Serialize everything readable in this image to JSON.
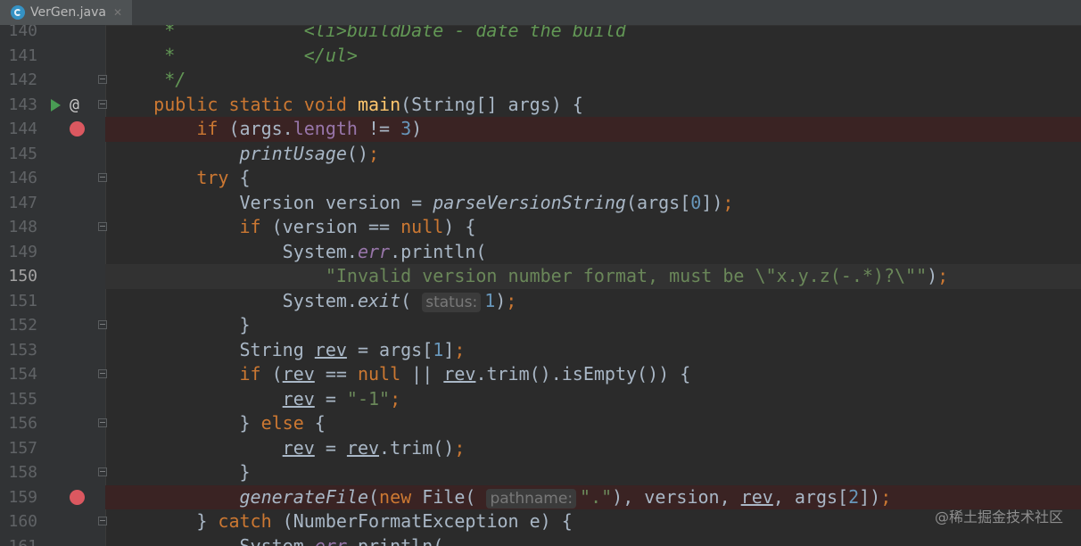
{
  "tab": {
    "label": "VerGen.java",
    "icon": "java-class-icon",
    "close": "✕"
  },
  "watermark": "@稀土掘金技术社区",
  "lines": [
    {
      "n": "140",
      "segs": [
        [
          "cmt",
          "     *            <li>buildDate - date the build"
        ]
      ]
    },
    {
      "n": "141",
      "segs": [
        [
          "cmt",
          "     *            </ul>"
        ]
      ]
    },
    {
      "n": "142",
      "fold": true,
      "segs": [
        [
          "cmt",
          "     */"
        ]
      ]
    },
    {
      "n": "143",
      "run": true,
      "at": "@",
      "fold": true,
      "segs": [
        [
          "kw",
          "    public static void "
        ],
        [
          "fn",
          "main"
        ],
        [
          "",
          "(String[] args) {"
        ]
      ]
    },
    {
      "n": "144",
      "bp": true,
      "segs": [
        [
          "kw",
          "        if "
        ],
        [
          "",
          "(args."
        ],
        [
          "fld",
          "length"
        ],
        [
          "",
          " != "
        ],
        [
          "num",
          "3"
        ],
        [
          "",
          ")"
        ]
      ]
    },
    {
      "n": "145",
      "segs": [
        [
          "ital",
          "            printUsage"
        ],
        [
          "",
          "()"
        ],
        [
          "kw",
          ";"
        ]
      ]
    },
    {
      "n": "146",
      "fold": true,
      "segs": [
        [
          "kw",
          "        try "
        ],
        [
          "",
          "{"
        ]
      ]
    },
    {
      "n": "147",
      "segs": [
        [
          "",
          "            Version version = "
        ],
        [
          "ital",
          "parseVersionString"
        ],
        [
          "",
          "(args["
        ],
        [
          "num",
          "0"
        ],
        [
          "",
          "])"
        ],
        [
          "kw",
          ";"
        ]
      ]
    },
    {
      "n": "148",
      "fold": true,
      "segs": [
        [
          "kw",
          "            if "
        ],
        [
          "",
          "(version == "
        ],
        [
          "kw",
          "null"
        ],
        [
          "",
          ") {"
        ]
      ]
    },
    {
      "n": "149",
      "segs": [
        [
          "",
          "                System."
        ],
        [
          "st",
          "err"
        ],
        [
          "",
          ".println("
        ]
      ]
    },
    {
      "n": "150",
      "caret": true,
      "segs": [
        [
          "str",
          "                    \"Invalid version number format, must be \\\"x.y.z(-.*)?\\\"\""
        ],
        [
          "",
          ")"
        ],
        [
          "kw",
          ";"
        ]
      ]
    },
    {
      "n": "151",
      "segs": [
        [
          "",
          "                System."
        ],
        [
          "ital",
          "exit"
        ],
        [
          "",
          "( "
        ],
        [
          "hint",
          "status:"
        ],
        [
          "num",
          "1"
        ],
        [
          "",
          ")"
        ],
        [
          "kw",
          ";"
        ]
      ]
    },
    {
      "n": "152",
      "fold": true,
      "segs": [
        [
          "",
          "            }"
        ]
      ]
    },
    {
      "n": "153",
      "segs": [
        [
          "",
          "            String "
        ],
        [
          "und",
          "rev"
        ],
        [
          "",
          " = args["
        ],
        [
          "num",
          "1"
        ],
        [
          "",
          "]"
        ],
        [
          "kw",
          ";"
        ]
      ]
    },
    {
      "n": "154",
      "fold": true,
      "segs": [
        [
          "kw",
          "            if "
        ],
        [
          "",
          "("
        ],
        [
          "und",
          "rev"
        ],
        [
          "",
          " == "
        ],
        [
          "kw",
          "null"
        ],
        [
          "",
          " || "
        ],
        [
          "und",
          "rev"
        ],
        [
          "",
          ".trim().isEmpty()) {"
        ]
      ]
    },
    {
      "n": "155",
      "segs": [
        [
          "",
          "                "
        ],
        [
          "und",
          "rev"
        ],
        [
          "",
          " = "
        ],
        [
          "str",
          "\"-1\""
        ],
        [
          "kw",
          ";"
        ]
      ]
    },
    {
      "n": "156",
      "fold": true,
      "segs": [
        [
          "",
          "            } "
        ],
        [
          "kw",
          "else "
        ],
        [
          "",
          "{"
        ]
      ]
    },
    {
      "n": "157",
      "segs": [
        [
          "",
          "                "
        ],
        [
          "und",
          "rev"
        ],
        [
          "",
          " = "
        ],
        [
          "und",
          "rev"
        ],
        [
          "",
          ".trim()"
        ],
        [
          "kw",
          ";"
        ]
      ]
    },
    {
      "n": "158",
      "fold": true,
      "segs": [
        [
          "",
          "            }"
        ]
      ]
    },
    {
      "n": "159",
      "bp": true,
      "segs": [
        [
          "ital",
          "            generateFile"
        ],
        [
          "",
          "("
        ],
        [
          "kw",
          "new "
        ],
        [
          "",
          "File( "
        ],
        [
          "hint",
          "pathname:"
        ],
        [
          "str",
          "\".\""
        ],
        [
          "",
          "), version, "
        ],
        [
          "und",
          "rev"
        ],
        [
          "",
          ", args["
        ],
        [
          "num",
          "2"
        ],
        [
          "",
          "])"
        ],
        [
          "kw",
          ";"
        ]
      ]
    },
    {
      "n": "160",
      "fold": true,
      "segs": [
        [
          "",
          "        } "
        ],
        [
          "kw",
          "catch "
        ],
        [
          "",
          "(NumberFormatException e) {"
        ]
      ]
    },
    {
      "n": "161",
      "segs": [
        [
          "",
          "            System."
        ],
        [
          "st",
          "err"
        ],
        [
          "",
          ".println("
        ]
      ]
    }
  ]
}
